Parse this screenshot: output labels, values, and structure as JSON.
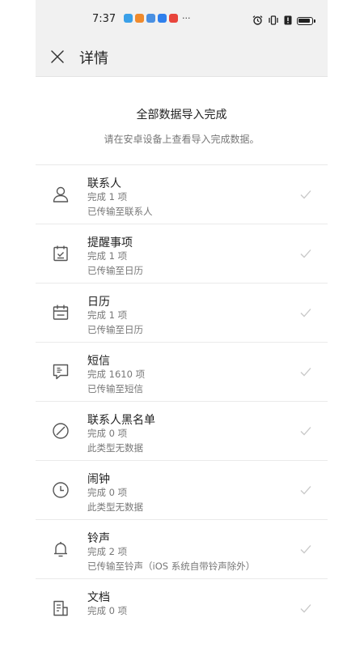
{
  "status_bar": {
    "time": "7:37",
    "more": "···"
  },
  "header": {
    "title": "详情",
    "close_icon": "close-icon"
  },
  "summary": {
    "title": "全部数据导入完成",
    "subtitle": "请在安卓设备上查看导入完成数据。"
  },
  "items": [
    {
      "name": "联系人",
      "count": "完成 1 项",
      "detail": "已传输至联系人",
      "icon": "person-icon"
    },
    {
      "name": "提醒事项",
      "count": "完成 1 项",
      "detail": "已传输至日历",
      "icon": "reminder-icon"
    },
    {
      "name": "日历",
      "count": "完成 1 项",
      "detail": "已传输至日历",
      "icon": "calendar-icon"
    },
    {
      "name": "短信",
      "count": "完成 1610 项",
      "detail": "已传输至短信",
      "icon": "message-icon"
    },
    {
      "name": "联系人黑名单",
      "count": "完成 0 项",
      "detail": "此类型无数据",
      "icon": "block-icon"
    },
    {
      "name": "闹钟",
      "count": "完成 0 项",
      "detail": "此类型无数据",
      "icon": "clock-icon"
    },
    {
      "name": "铃声",
      "count": "完成 2 项",
      "detail": "已传输至铃声（iOS 系统自带铃声除外）",
      "icon": "bell-icon"
    },
    {
      "name": "文档",
      "count": "完成 0 项",
      "detail": "",
      "icon": "document-icon"
    }
  ],
  "colors": {
    "header_bg": "#f1f1f1",
    "secondary_text": "#777777",
    "icon_stroke": "#555555",
    "check": "#c8c8c8"
  }
}
